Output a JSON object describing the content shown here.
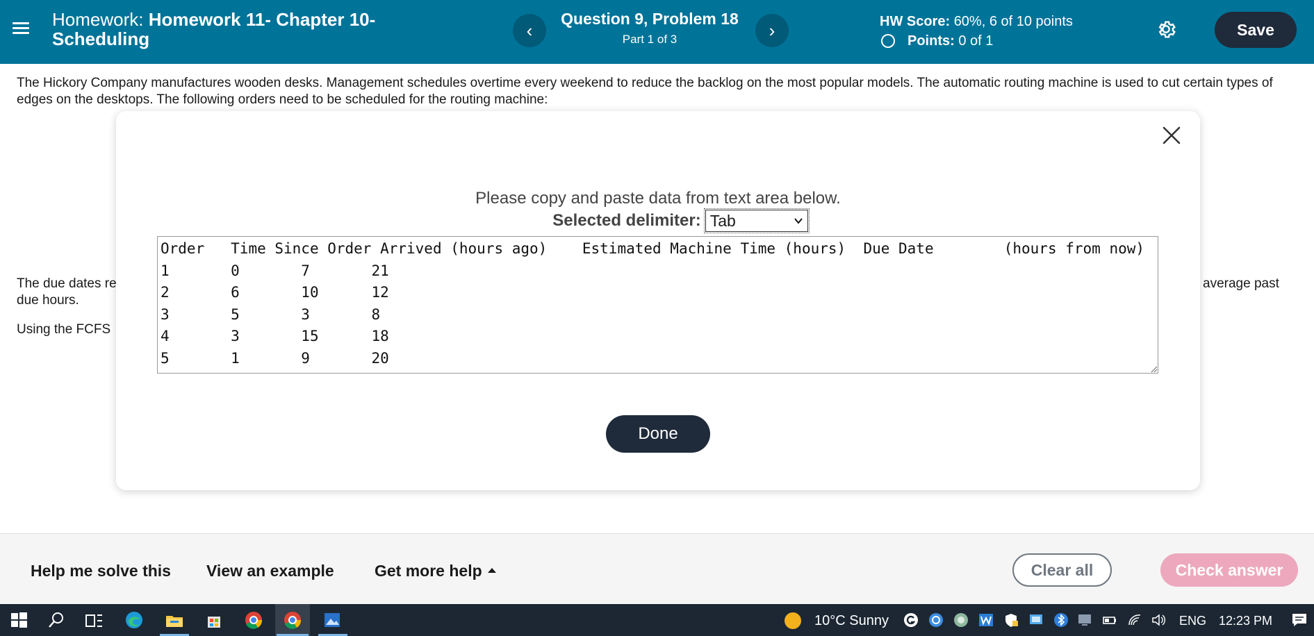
{
  "header": {
    "title_prefix": "Homework:",
    "title_name": "Homework 11- Chapter 10- Scheduling",
    "question_title": "Question 9, Problem 18",
    "question_part": "Part 1 of 3",
    "hw_score_label": "HW Score:",
    "hw_score_value": "60%, 6 of 10 points",
    "points_label": "Points:",
    "points_value": "0 of 1",
    "save_label": "Save",
    "prev_glyph": "‹",
    "next_glyph": "›"
  },
  "body": {
    "intro": "The Hickory Company manufactures wooden desks. Management schedules overtime every weekend to reduce the backlog on the most popular models. The automatic routing machine is used to cut certain types of edges on the desktops. The following orders need to be scheduled for the routing machine:",
    "due_left": "The due dates re",
    "due_left2": "due hours.",
    "due_right": "average past",
    "using_left": "Using the FCFS"
  },
  "modal": {
    "instruction": "Please copy and paste data from text area below.",
    "delimiter_label": "Selected delimiter:",
    "delimiter_value": "Tab",
    "data_text": "Order\tTime Since Order Arrived (hours ago)\tEstimated Machine Time (hours)\tDue Date\t(hours from now)\n1\t0\t7\t21\n2\t6\t10\t12\n3\t5\t3\t8\n4\t3\t15\t18\n5\t1\t9\t20",
    "done_label": "Done"
  },
  "footer": {
    "help_solve": "Help me solve this",
    "view_example": "View an example",
    "more_help": "Get more help",
    "clear_all": "Clear all",
    "check_answer": "Check answer"
  },
  "taskbar": {
    "weather": "10°C  Sunny",
    "language": "ENG",
    "time": "12:23 PM"
  },
  "colors": {
    "header_bg": "#007398",
    "dark_button": "#1f2a3a",
    "check_answer_bg": "#eda8bd",
    "taskbar_bg": "#1c2733"
  }
}
